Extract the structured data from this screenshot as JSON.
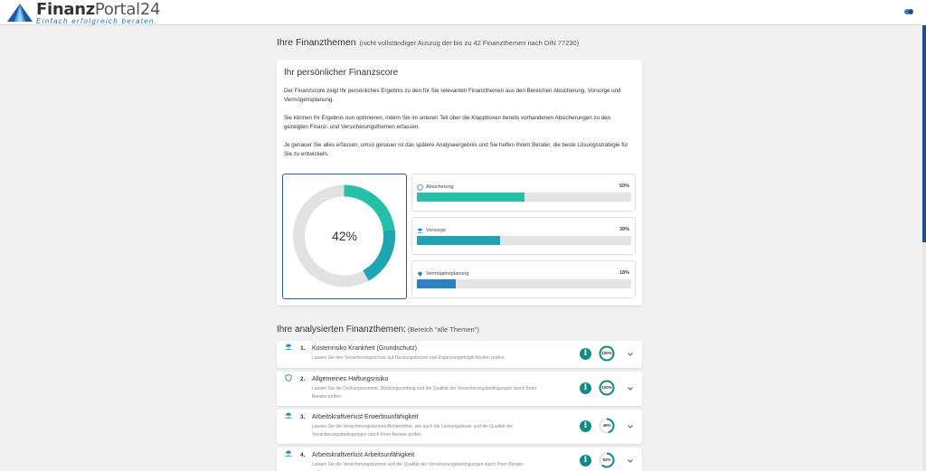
{
  "header": {
    "brand_main": "Finanz",
    "brand_rest": "Portal",
    "brand_num": "24",
    "tagline": "Einfach erfolgreich beraten."
  },
  "themes": {
    "title": "Ihre Finanzthemen",
    "subtitle": "(nicht vollständiger Auszug der bis zu 42 Finanzthemen nach DIN 77230)"
  },
  "score": {
    "title": "Ihr persönlicher Finanzscore",
    "paragraphs": [
      "Der Finanzscore zeigt Ihr persönliches Ergebnis zu den für Sie relevanten Finanzthemen aus den Bereichen Absicherung, Vorsorge und Vermögensplanung.",
      "Sie können Ihr Ergebnis nun optimieren, indem Sie im unteren Teil über die Klappboxen bereits vorhandenen Absicherungen zu den gezeigten Finanz- und Versicherungsthemen erfassen.",
      "Je genauer Sie alles erfassen, umso genauer ist das spätere Analyseergebnis und Sie helfen Ihrem Berater, die beste Lösungsstrategie für Sie zu entwickeln."
    ],
    "total_label": "42%",
    "total_value": 42,
    "categories": [
      {
        "name": "Absicherung",
        "pct_label": "50%",
        "value": 50,
        "color": "#26c0a8",
        "icon": "shield-icon"
      },
      {
        "name": "Vorsorge",
        "pct_label": "39%",
        "value": 39,
        "color": "#20a3b3",
        "icon": "umbrella-hand-icon"
      },
      {
        "name": "Vermögensplanung",
        "pct_label": "18%",
        "value": 18,
        "color": "#2a82c6",
        "icon": "diamond-icon"
      }
    ]
  },
  "analysed": {
    "title": "Ihre analysierten Finanzthemen:",
    "filter": "(Bereich \"alle Themen\")",
    "topics": [
      {
        "num": "1.",
        "title": "Kostenrisiko Krankheit (Grundschutz)",
        "desc": "Lassen Sie den Versicherungsschutz auf Deckungslücken und Ergänzungsmöglichkeiten prüfen.",
        "ring_label": "100%",
        "value": 100,
        "icon": "umbrella-hand-icon"
      },
      {
        "num": "2.",
        "title": "Allgemeines Haftungsrisiko",
        "desc": "Lassen Sie die Deckungssumme, Deckungsumfang und die Qualität der Versicherungsbedingungen durch Ihren Berater prüfen.",
        "ring_label": "100%",
        "value": 100,
        "icon": "shield-icon"
      },
      {
        "num": "3.",
        "title": "Arbeitskraftverlust Erwerbsunfähigkeit",
        "desc": "Lassen Sie die Versicherungssumme/Rentenhöhe, wie auch die Leistungsdauer und die Qualität der Versicherungsbedingungen durch Ihren Berater prüfen.",
        "ring_label": "46%",
        "value": 46,
        "icon": "umbrella-hand-icon"
      },
      {
        "num": "4.",
        "title": "Arbeitskraftverlust Arbeitsunfähigkeit",
        "desc": "Lassen Sie die Versicherungssumme und die Qualität der Versicherungsbedingungen durch Ihren Berater prüfen.",
        "ring_label": "62%",
        "value": 62,
        "icon": "umbrella-hand-icon"
      }
    ]
  },
  "info_glyph": "i",
  "colors": {
    "accent_teal": "#26c0a8",
    "accent_blue": "#2a82c6",
    "info_button": "#0f8c86",
    "donut_track": "#e2e2e2",
    "frame_blue": "#2d5a9b"
  }
}
